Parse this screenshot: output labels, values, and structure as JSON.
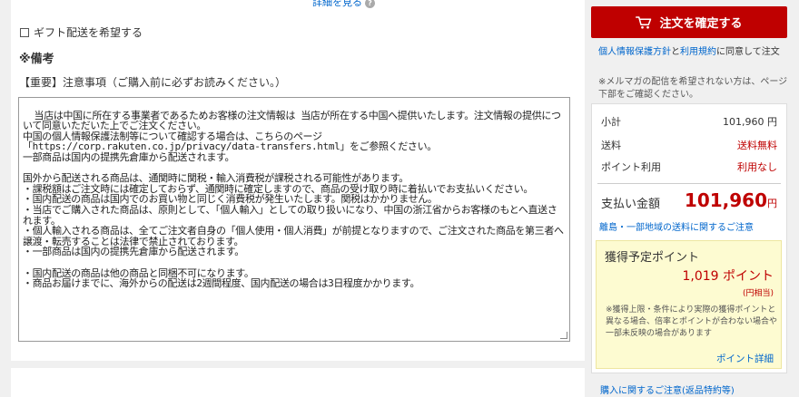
{
  "left": {
    "detail_link": "詳細を見る",
    "gift_label": "ギフト配送を希望する",
    "remarks_title": "※備考",
    "notice_title": "【重要】注意事項（ご購入前に必ずお読みください。）",
    "notes_text": "当店は中国に所在する事業者であるためお客様の注文情報は 当店が所在する中国へ提供いたします。注文情報の提供について同意いただいた上でご注文ください。\n中国の個人情報保護法制等について確認する場合は、こちらのページ\n「https://corp.rakuten.co.jp/privacy/data-transfers.html」をご参照ください。\n一部商品は国内の提携先倉庫から配送されます。\n\n国外から配送される商品は、通関時に関税・輸入消費税が課税される可能性があります。\n・課税額はご注文時には確定しておらず、通関時に確定しますので、商品の受け取り時に着払いでお支払いください。\n・国内配送の商品は国内でのお買い物と同じく消費税が発生いたします。関税はかかりません。\n・当店でご購入された商品は、原則として、「個人輸入」としての取り扱いになり、中国の浙江省からお客様のもとへ直送されます。\n・個人輸入される商品は、全てご注文者自身の「個人使用・個人消費」が前提となりますので、ご注文された商品を第三者へ譲渡・転売することは法律で禁止されております。\n・一部商品は国内の提携先倉庫から配送されます。\n\n・国内配送の商品は他の商品と同梱不可になります。\n・商品お届けまでに、海外からの配送は2週間程度、国内配送の場合は3日程度かかります。"
  },
  "right": {
    "order_button": "注文を確定する",
    "privacy_link1": "個人情報保護方針",
    "privacy_and": "と",
    "privacy_link2": "利用規約",
    "privacy_suffix": "に同意して注文",
    "mail_note": "※メルマガの配信を希望されない方は、ページ下部をご確認ください。",
    "summary": {
      "subtotal_label": "小計",
      "subtotal_value": "101,960 円",
      "shipping_label": "送料",
      "shipping_value": "送料無料",
      "points_use_label": "ポイント利用",
      "points_use_value": "利用なし",
      "pay_label": "支払い金額",
      "pay_value": "101,960",
      "pay_unit": "円",
      "island_link": "離島・一部地域の送料に関するご注意"
    },
    "points": {
      "title": "獲得予定ポイント",
      "value": "1,019 ポイント",
      "equiv": "(円相当)",
      "note": "※獲得上限・条件により実際の獲得ポイントと異なる場合、倍率とポイントが合わない場合や一部未反映の場合があります",
      "detail_link": "ポイント詳細"
    },
    "purchase_note": "購入に関するご注意(返品特約等)"
  },
  "colors": {
    "accent_red": "#bf0000",
    "link_blue": "#0066cc",
    "points_bg": "#fdfbd1"
  }
}
